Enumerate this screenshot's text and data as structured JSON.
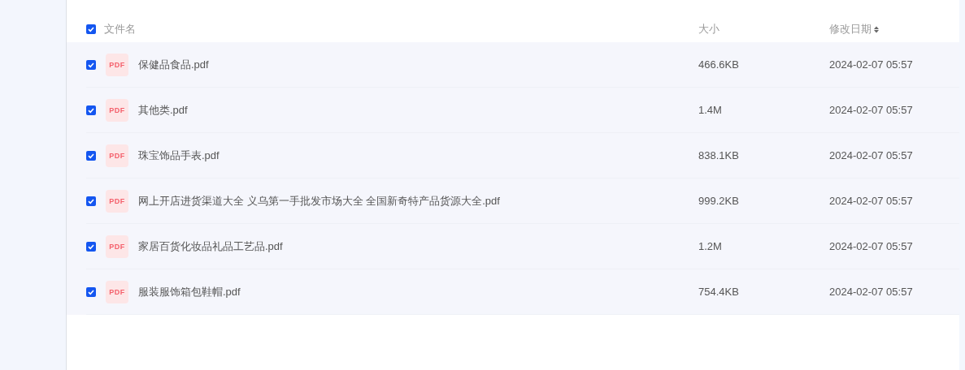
{
  "table": {
    "select_all": {
      "checked": true
    },
    "columns": [
      {
        "label": "文件名"
      },
      {
        "label": "大小"
      },
      {
        "label": "修改日期",
        "sortable": true
      }
    ],
    "rows": [
      {
        "checked": true,
        "type_label": "PDF",
        "name": "保健品食品.pdf",
        "size": "466.6KB",
        "modified": "2024-02-07 05:57"
      },
      {
        "checked": true,
        "type_label": "PDF",
        "name": "其他类.pdf",
        "size": "1.4M",
        "modified": "2024-02-07 05:57"
      },
      {
        "checked": true,
        "type_label": "PDF",
        "name": "珠宝饰品手表.pdf",
        "size": "838.1KB",
        "modified": "2024-02-07 05:57"
      },
      {
        "checked": true,
        "type_label": "PDF",
        "name": "网上开店进货渠道大全 义乌第一手批发市场大全 全国新奇特产品货源大全.pdf",
        "size": "999.2KB",
        "modified": "2024-02-07 05:57"
      },
      {
        "checked": true,
        "type_label": "PDF",
        "name": "家居百货化妆品礼品工艺品.pdf",
        "size": "1.2M",
        "modified": "2024-02-07 05:57"
      },
      {
        "checked": true,
        "type_label": "PDF",
        "name": "服装服饰箱包鞋帽.pdf",
        "size": "754.4KB",
        "modified": "2024-02-07 05:57"
      }
    ]
  }
}
